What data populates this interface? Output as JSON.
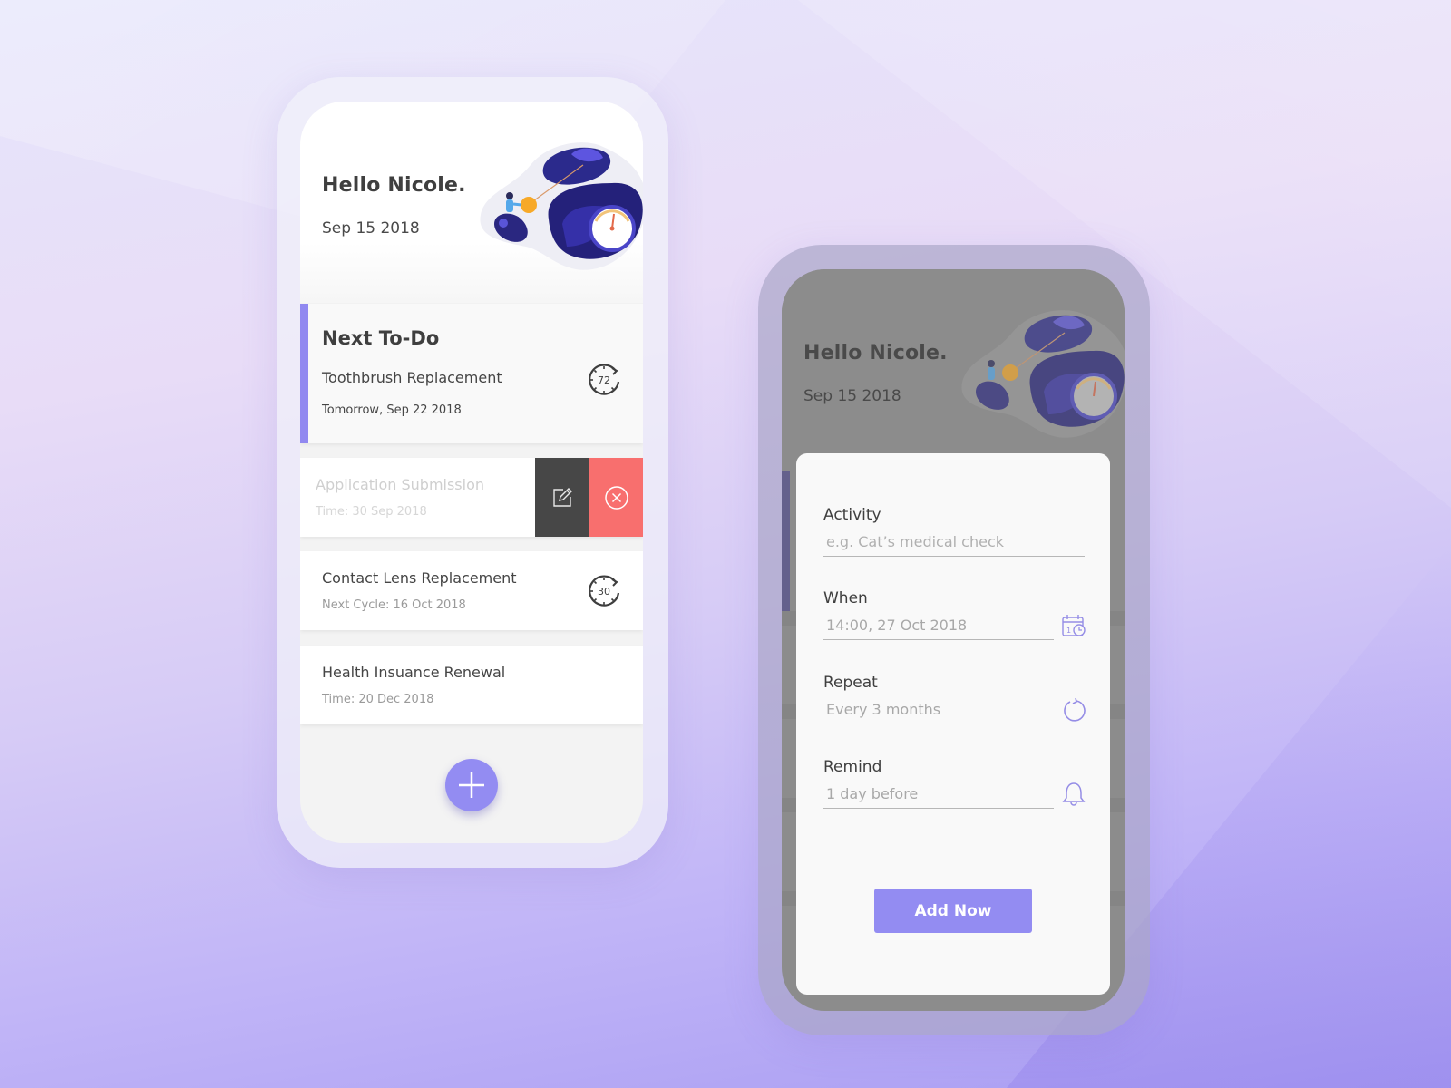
{
  "colors": {
    "accent": "#938cf2",
    "delete": "#f86f6e",
    "edit": "#474747",
    "text_dark": "#3f3f3f",
    "text_muted": "#9a9a9a"
  },
  "home_screen": {
    "greeting": "Hello Nicole.",
    "date": "Sep 15 2018",
    "next_todo": {
      "heading": "Next To-Do",
      "task": "Toothbrush Replacement",
      "when": "Tomorrow, Sep 22 2018",
      "cycle_badge": "72",
      "icon": "timer-cycle-icon"
    },
    "swiped_item": {
      "title": "Application Submission",
      "subtitle": "Time: 30 Sep 2018",
      "actions": [
        {
          "name": "edit",
          "icon": "edit-pencil-icon"
        },
        {
          "name": "delete",
          "icon": "close-circle-icon"
        }
      ]
    },
    "items": [
      {
        "title": "Contact Lens Replacement",
        "subtitle": "Next Cycle: 16 Oct 2018",
        "cycle_badge": "30",
        "icon": "timer-cycle-icon"
      },
      {
        "title": "Health Insuance Renewal",
        "subtitle": "Time: 20 Dec 2018"
      }
    ],
    "fab_icon": "plus-icon"
  },
  "add_screen": {
    "greeting": "Hello Nicole.",
    "date": "Sep 15 2018",
    "form": {
      "activity": {
        "label": "Activity",
        "placeholder": "e.g. Cat’s medical check",
        "value": ""
      },
      "when": {
        "label": "When",
        "value": "14:00, 27 Oct 2018",
        "icon": "calendar-clock-icon"
      },
      "repeat": {
        "label": "Repeat",
        "value": "Every 3 months",
        "icon": "repeat-icon"
      },
      "remind": {
        "label": "Remind",
        "value": "1 day before",
        "icon": "bell-icon"
      }
    },
    "submit_label": "Add Now"
  }
}
